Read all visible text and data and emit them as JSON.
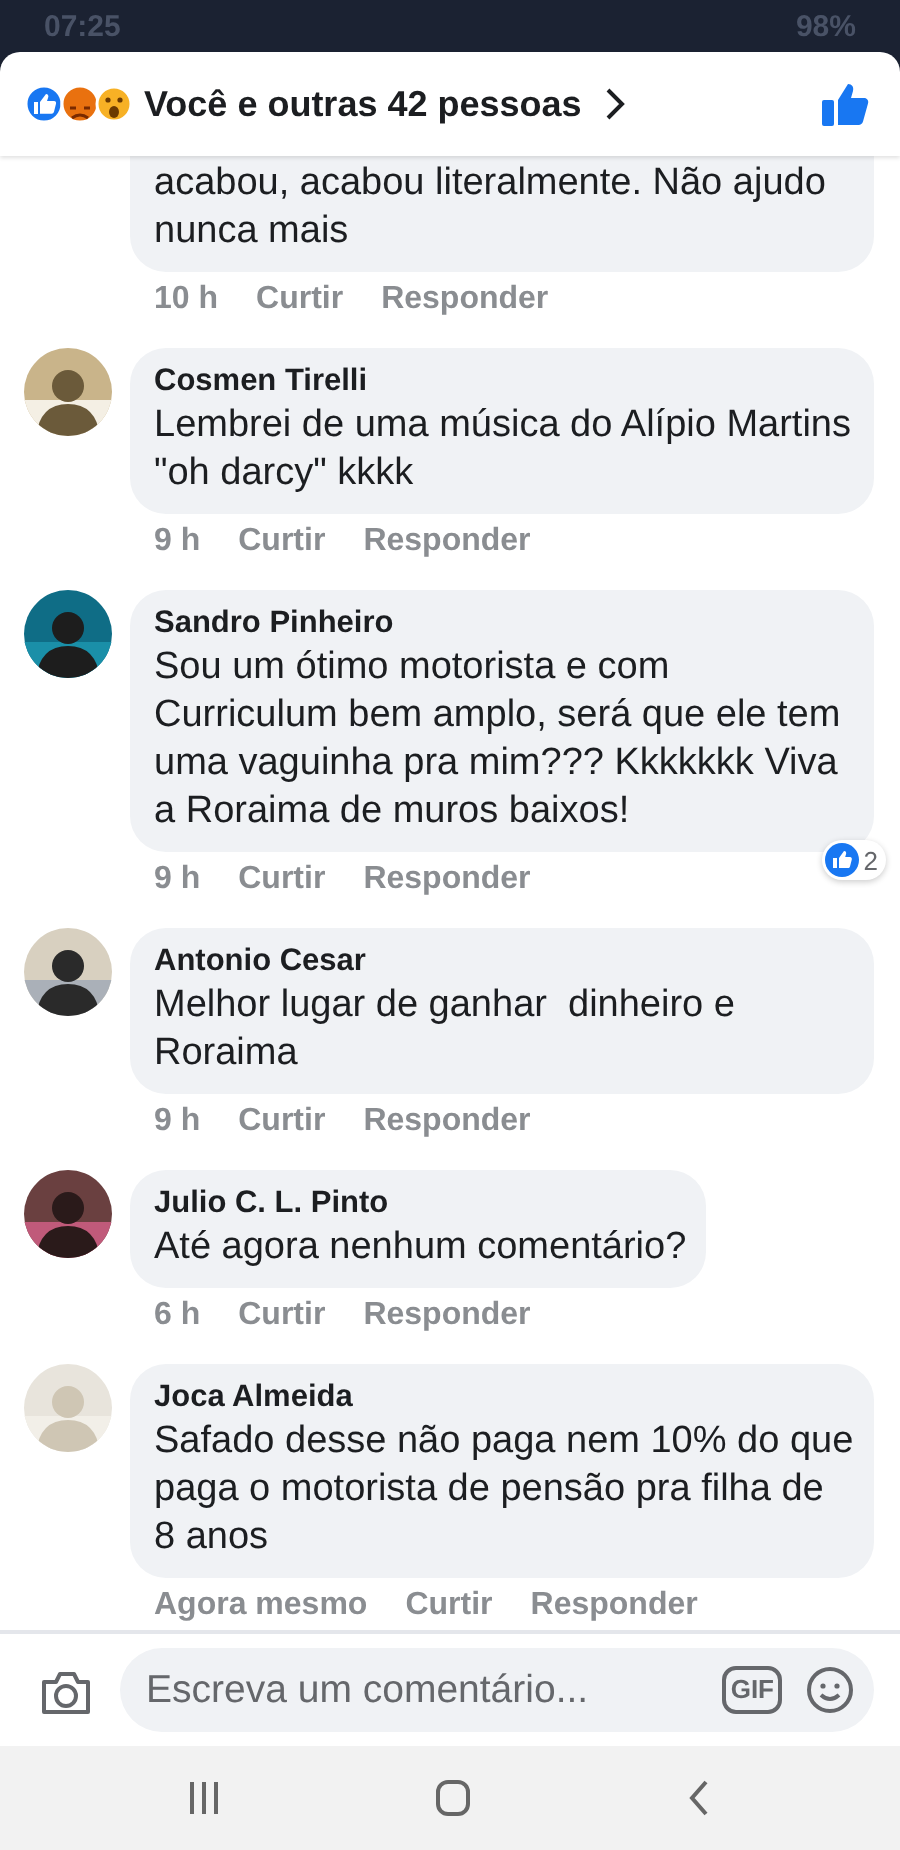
{
  "status_bar": {
    "time": "07:25",
    "battery": "98%"
  },
  "header": {
    "reactions_summary": "Você e outras 42 pessoas",
    "liked": true
  },
  "comments": [
    {
      "kind": "partial",
      "text": "acabou, acabou literalmente. Não ajudo\nnunca mais",
      "time": "10 h",
      "like": "Curtir",
      "reply": "Responder"
    },
    {
      "kind": "full",
      "name": "Cosmen Tirelli",
      "text": "Lembrei de uma música do Alípio Martins \"oh darcy\" kkkk",
      "time": "9 h",
      "like": "Curtir",
      "reply": "Responder"
    },
    {
      "kind": "full",
      "name": "Sandro Pinheiro",
      "text": "Sou um ótimo motorista e com Curriculum bem amplo, será que ele tem uma vaguinha pra mim??? Kkkkkkk Viva a Roraima de muros baixos!",
      "time": "9 h",
      "like": "Curtir",
      "reply": "Responder",
      "reaction_count": "2"
    },
    {
      "kind": "full",
      "name": "Antonio Cesar",
      "text": "Melhor lugar de ganhar  dinheiro e Roraima",
      "time": "9 h",
      "like": "Curtir",
      "reply": "Responder"
    },
    {
      "kind": "full",
      "name": "Julio C. L. Pinto",
      "text": "Até agora nenhum comentário?",
      "time": "6 h",
      "like": "Curtir",
      "reply": "Responder"
    },
    {
      "kind": "full",
      "name": "Joca Almeida",
      "text": "Safado desse não paga nem 10% do que paga o motorista de pensão pra filha de 8 anos",
      "time": "Agora mesmo",
      "like": "Curtir",
      "reply": "Responder"
    }
  ],
  "composer": {
    "placeholder": "Escreva um comentário...",
    "gif": "GIF"
  }
}
